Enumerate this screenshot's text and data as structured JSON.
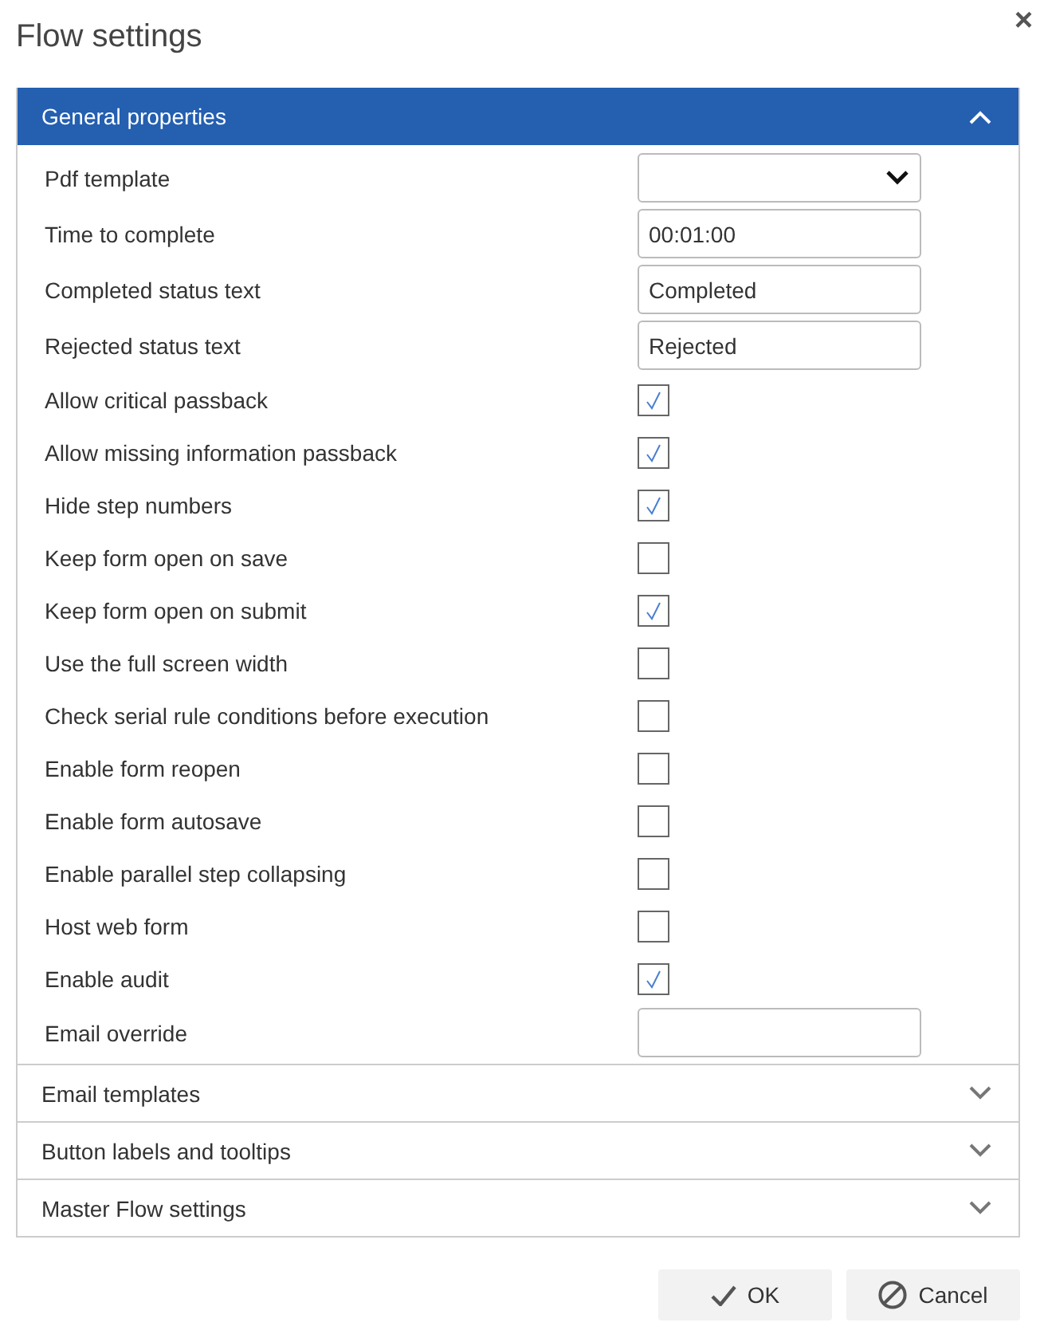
{
  "dialog": {
    "title": "Flow settings",
    "close_icon": "×"
  },
  "sections": [
    {
      "title": "General properties",
      "expanded": true,
      "fields": [
        {
          "kind": "select",
          "label": "Pdf template"
        },
        {
          "kind": "text",
          "label": "Time to complete",
          "value": "00:01:00"
        },
        {
          "kind": "text",
          "label": "Completed status text",
          "value": "Completed"
        },
        {
          "kind": "text",
          "label": "Rejected status text",
          "value": "Rejected"
        },
        {
          "kind": "checkbox",
          "label": "Allow critical passback",
          "checked": true
        },
        {
          "kind": "checkbox",
          "label": "Allow missing information passback",
          "checked": true
        },
        {
          "kind": "checkbox",
          "label": "Hide step numbers",
          "checked": true
        },
        {
          "kind": "checkbox",
          "label": "Keep form open on save",
          "checked": false
        },
        {
          "kind": "checkbox",
          "label": "Keep form open on submit",
          "checked": true
        },
        {
          "kind": "checkbox",
          "label": "Use the full screen width",
          "checked": false
        },
        {
          "kind": "checkbox",
          "label": "Check serial rule conditions before execution",
          "checked": false
        },
        {
          "kind": "checkbox",
          "label": "Enable form reopen",
          "checked": false
        },
        {
          "kind": "checkbox",
          "label": "Enable form autosave",
          "checked": false
        },
        {
          "kind": "checkbox",
          "label": "Enable parallel step collapsing",
          "checked": false
        },
        {
          "kind": "checkbox",
          "label": "Host web form",
          "checked": false
        },
        {
          "kind": "checkbox",
          "label": "Enable audit",
          "checked": true
        },
        {
          "kind": "text",
          "label": "Email override"
        }
      ]
    },
    {
      "title": "Email templates",
      "expanded": false
    },
    {
      "title": "Button labels and tooltips",
      "expanded": false
    },
    {
      "title": "Master Flow settings",
      "expanded": false
    }
  ],
  "buttons": [
    {
      "kind": "ok",
      "label": "OK"
    },
    {
      "kind": "cancel",
      "label": "Cancel"
    }
  ]
}
